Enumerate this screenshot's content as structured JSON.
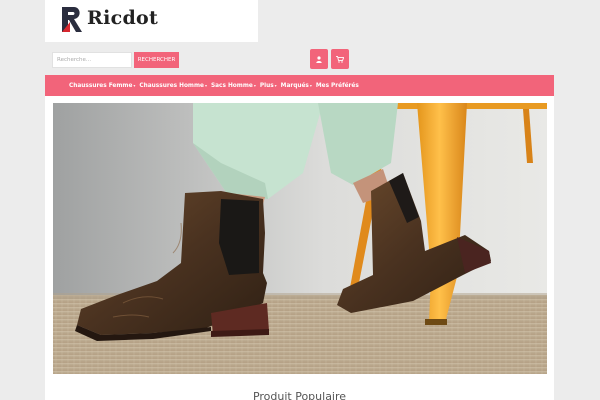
{
  "brand": {
    "name": "Ricdot",
    "logo_colors": {
      "dark": "#2a2d3e",
      "accent": "#d8272f"
    }
  },
  "search": {
    "placeholder": "Recherche...",
    "button_label": "RECHERCHER"
  },
  "header_icons": [
    {
      "name": "user-icon"
    },
    {
      "name": "cart-icon"
    }
  ],
  "nav": {
    "items": [
      {
        "label": "Chaussures Femme",
        "dropdown": true
      },
      {
        "label": "Chaussures Homme",
        "dropdown": true
      },
      {
        "label": "Sacs Homme",
        "dropdown": true
      },
      {
        "label": "Plus",
        "dropdown": true
      },
      {
        "label": "Marqués",
        "dropdown": true
      },
      {
        "label": "Mes Préférés",
        "dropdown": false
      }
    ]
  },
  "hero": {
    "image": "photo-chelsea-boots-on-woven-rug-with-orange-chair"
  },
  "section": {
    "title": "Produit Populaire"
  },
  "colors": {
    "accent": "#f2647a",
    "background": "#ececec"
  }
}
